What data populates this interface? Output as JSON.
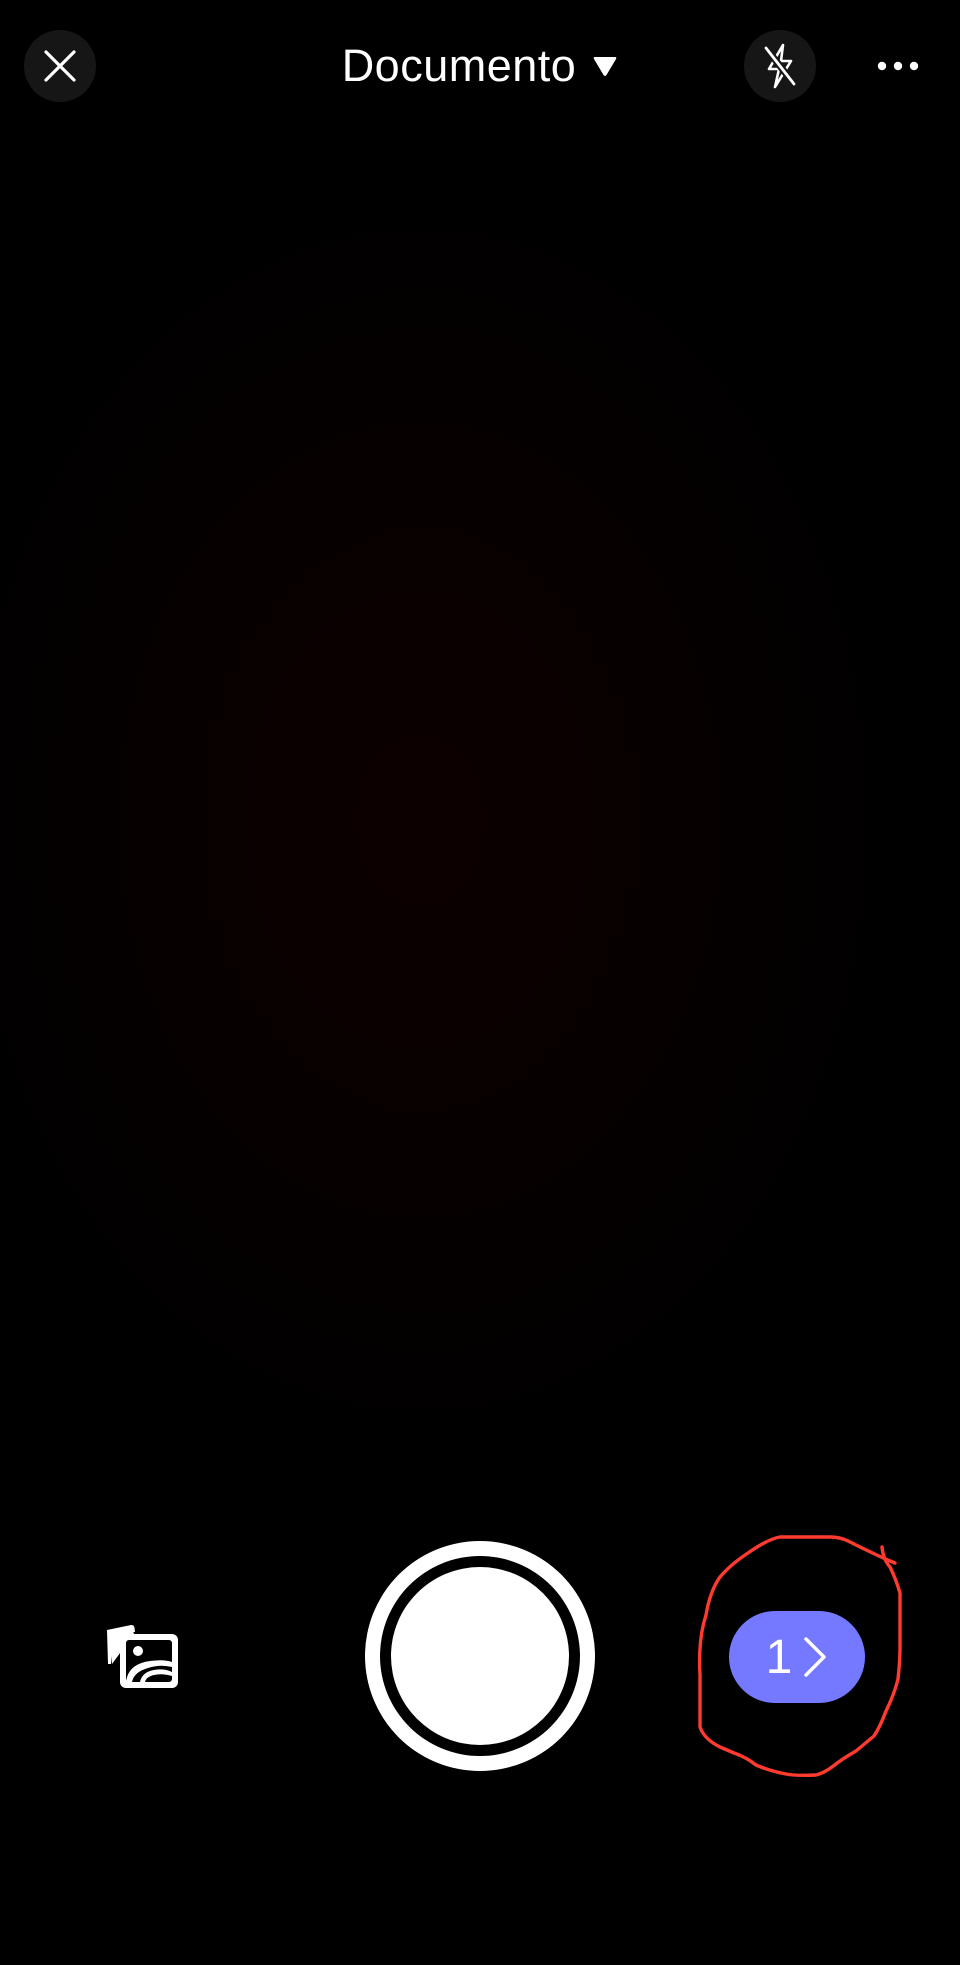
{
  "header": {
    "mode_label": "Documento",
    "close_icon": "close-icon",
    "mode_dropdown_icon": "triangle-down-icon",
    "flash_icon": "flash-off-icon",
    "more_icon": "more-horizontal-icon"
  },
  "bottom_controls": {
    "gallery_icon": "photo-library-icon",
    "shutter_icon": "shutter-button",
    "pages_count": "1",
    "pages_icon": "chevron-right-icon"
  },
  "colors": {
    "background": "#000000",
    "accent": "#7479ff",
    "annotation": "#ff3b30"
  }
}
